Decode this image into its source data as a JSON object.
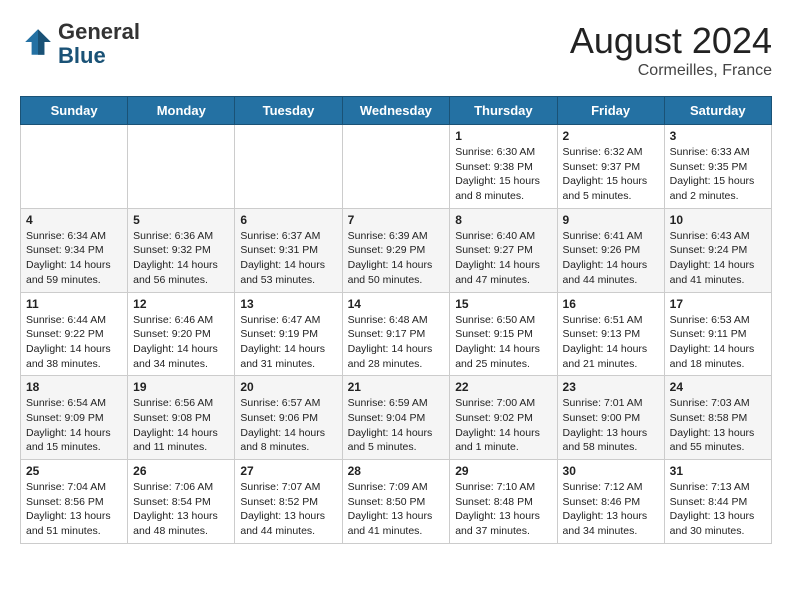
{
  "header": {
    "logo_general": "General",
    "logo_blue": "Blue",
    "month_year": "August 2024",
    "location": "Cormeilles, France"
  },
  "days_of_week": [
    "Sunday",
    "Monday",
    "Tuesday",
    "Wednesday",
    "Thursday",
    "Friday",
    "Saturday"
  ],
  "weeks": [
    [
      {
        "day": "",
        "info": ""
      },
      {
        "day": "",
        "info": ""
      },
      {
        "day": "",
        "info": ""
      },
      {
        "day": "",
        "info": ""
      },
      {
        "day": "1",
        "info": "Sunrise: 6:30 AM\nSunset: 9:38 PM\nDaylight: 15 hours\nand 8 minutes."
      },
      {
        "day": "2",
        "info": "Sunrise: 6:32 AM\nSunset: 9:37 PM\nDaylight: 15 hours\nand 5 minutes."
      },
      {
        "day": "3",
        "info": "Sunrise: 6:33 AM\nSunset: 9:35 PM\nDaylight: 15 hours\nand 2 minutes."
      }
    ],
    [
      {
        "day": "4",
        "info": "Sunrise: 6:34 AM\nSunset: 9:34 PM\nDaylight: 14 hours\nand 59 minutes."
      },
      {
        "day": "5",
        "info": "Sunrise: 6:36 AM\nSunset: 9:32 PM\nDaylight: 14 hours\nand 56 minutes."
      },
      {
        "day": "6",
        "info": "Sunrise: 6:37 AM\nSunset: 9:31 PM\nDaylight: 14 hours\nand 53 minutes."
      },
      {
        "day": "7",
        "info": "Sunrise: 6:39 AM\nSunset: 9:29 PM\nDaylight: 14 hours\nand 50 minutes."
      },
      {
        "day": "8",
        "info": "Sunrise: 6:40 AM\nSunset: 9:27 PM\nDaylight: 14 hours\nand 47 minutes."
      },
      {
        "day": "9",
        "info": "Sunrise: 6:41 AM\nSunset: 9:26 PM\nDaylight: 14 hours\nand 44 minutes."
      },
      {
        "day": "10",
        "info": "Sunrise: 6:43 AM\nSunset: 9:24 PM\nDaylight: 14 hours\nand 41 minutes."
      }
    ],
    [
      {
        "day": "11",
        "info": "Sunrise: 6:44 AM\nSunset: 9:22 PM\nDaylight: 14 hours\nand 38 minutes."
      },
      {
        "day": "12",
        "info": "Sunrise: 6:46 AM\nSunset: 9:20 PM\nDaylight: 14 hours\nand 34 minutes."
      },
      {
        "day": "13",
        "info": "Sunrise: 6:47 AM\nSunset: 9:19 PM\nDaylight: 14 hours\nand 31 minutes."
      },
      {
        "day": "14",
        "info": "Sunrise: 6:48 AM\nSunset: 9:17 PM\nDaylight: 14 hours\nand 28 minutes."
      },
      {
        "day": "15",
        "info": "Sunrise: 6:50 AM\nSunset: 9:15 PM\nDaylight: 14 hours\nand 25 minutes."
      },
      {
        "day": "16",
        "info": "Sunrise: 6:51 AM\nSunset: 9:13 PM\nDaylight: 14 hours\nand 21 minutes."
      },
      {
        "day": "17",
        "info": "Sunrise: 6:53 AM\nSunset: 9:11 PM\nDaylight: 14 hours\nand 18 minutes."
      }
    ],
    [
      {
        "day": "18",
        "info": "Sunrise: 6:54 AM\nSunset: 9:09 PM\nDaylight: 14 hours\nand 15 minutes."
      },
      {
        "day": "19",
        "info": "Sunrise: 6:56 AM\nSunset: 9:08 PM\nDaylight: 14 hours\nand 11 minutes."
      },
      {
        "day": "20",
        "info": "Sunrise: 6:57 AM\nSunset: 9:06 PM\nDaylight: 14 hours\nand 8 minutes."
      },
      {
        "day": "21",
        "info": "Sunrise: 6:59 AM\nSunset: 9:04 PM\nDaylight: 14 hours\nand 5 minutes."
      },
      {
        "day": "22",
        "info": "Sunrise: 7:00 AM\nSunset: 9:02 PM\nDaylight: 14 hours\nand 1 minute."
      },
      {
        "day": "23",
        "info": "Sunrise: 7:01 AM\nSunset: 9:00 PM\nDaylight: 13 hours\nand 58 minutes."
      },
      {
        "day": "24",
        "info": "Sunrise: 7:03 AM\nSunset: 8:58 PM\nDaylight: 13 hours\nand 55 minutes."
      }
    ],
    [
      {
        "day": "25",
        "info": "Sunrise: 7:04 AM\nSunset: 8:56 PM\nDaylight: 13 hours\nand 51 minutes."
      },
      {
        "day": "26",
        "info": "Sunrise: 7:06 AM\nSunset: 8:54 PM\nDaylight: 13 hours\nand 48 minutes."
      },
      {
        "day": "27",
        "info": "Sunrise: 7:07 AM\nSunset: 8:52 PM\nDaylight: 13 hours\nand 44 minutes."
      },
      {
        "day": "28",
        "info": "Sunrise: 7:09 AM\nSunset: 8:50 PM\nDaylight: 13 hours\nand 41 minutes."
      },
      {
        "day": "29",
        "info": "Sunrise: 7:10 AM\nSunset: 8:48 PM\nDaylight: 13 hours\nand 37 minutes."
      },
      {
        "day": "30",
        "info": "Sunrise: 7:12 AM\nSunset: 8:46 PM\nDaylight: 13 hours\nand 34 minutes."
      },
      {
        "day": "31",
        "info": "Sunrise: 7:13 AM\nSunset: 8:44 PM\nDaylight: 13 hours\nand 30 minutes."
      }
    ]
  ]
}
